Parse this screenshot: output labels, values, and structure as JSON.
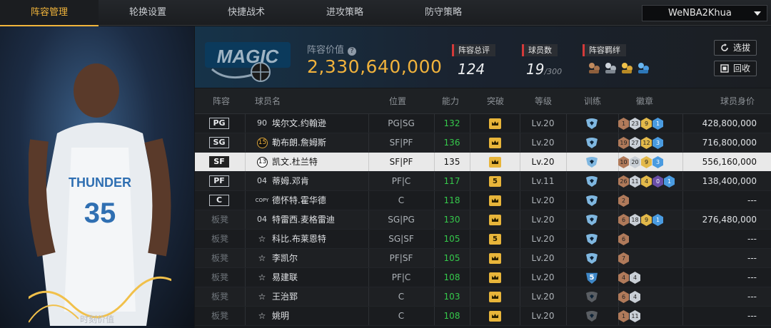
{
  "tabs": [
    "阵容管理",
    "轮换设置",
    "快捷战术",
    "进攻策略",
    "防守策略"
  ],
  "user": {
    "name": "WeNBA2Khua"
  },
  "player_panel": {
    "time_value_label": "时刻价值"
  },
  "summary": {
    "lineup_value_label": "阵容价值",
    "lineup_value": "2,330,640,000",
    "overall_label": "阵容总评",
    "overall_value": "124",
    "players_label": "球员数",
    "players_value": "19",
    "players_max": "/300",
    "bonds_label": "阵容羁绊",
    "btn_select": "选拔",
    "btn_recycle": "回收"
  },
  "columns": {
    "lineup": "阵容",
    "name": "球员名",
    "position": "位置",
    "ability": "能力",
    "breakthrough": "突破",
    "level": "等级",
    "training": "训练",
    "badges": "徽章",
    "value": "球员身价"
  },
  "colors": {
    "accent": "#f2b53b",
    "ability_green": "#35c94b",
    "stat_red": "#d43a3a"
  },
  "rows": [
    {
      "slot": "PG",
      "bench": false,
      "num": "90",
      "num_type": "plain",
      "name": "埃尔文.约翰逊",
      "position": "PG|SG",
      "ability": "132",
      "break": "crown",
      "level": "Lv.20",
      "training": "crest",
      "badges": [
        {
          "t": "bronze",
          "v": "1"
        },
        {
          "t": "silver",
          "v": "23"
        },
        {
          "t": "gold",
          "v": "9"
        },
        {
          "t": "blue",
          "v": "1"
        }
      ],
      "value": "428,800,000",
      "selected": false
    },
    {
      "slot": "SG",
      "bench": false,
      "num": "15",
      "num_type": "badge",
      "name": "勒布朗.詹姆斯",
      "position": "SF|PF",
      "ability": "136",
      "break": "crown",
      "level": "Lv.20",
      "training": "crest",
      "badges": [
        {
          "t": "bronze",
          "v": "19"
        },
        {
          "t": "silver",
          "v": "27"
        },
        {
          "t": "gold",
          "v": "12"
        },
        {
          "t": "blue",
          "v": "3"
        }
      ],
      "value": "716,800,000",
      "selected": false
    },
    {
      "slot": "SF",
      "bench": false,
      "num": "13",
      "num_type": "badge",
      "name": "凯文.杜兰特",
      "position": "SF|PF",
      "ability": "135",
      "break": "crown",
      "level": "Lv.20",
      "training": "crest",
      "badges": [
        {
          "t": "bronze",
          "v": "10"
        },
        {
          "t": "silver",
          "v": "20"
        },
        {
          "t": "gold",
          "v": "9"
        },
        {
          "t": "blue",
          "v": "3"
        }
      ],
      "value": "556,160,000",
      "selected": true
    },
    {
      "slot": "PF",
      "bench": false,
      "num": "04",
      "num_type": "plain",
      "name": "蒂姆.邓肯",
      "position": "PF|C",
      "ability": "117",
      "break": "5",
      "level": "Lv.11",
      "training": "crest",
      "badges": [
        {
          "t": "bronze",
          "v": "26"
        },
        {
          "t": "silver",
          "v": "11"
        },
        {
          "t": "gold",
          "v": "4"
        },
        {
          "t": "purple",
          "v": "0"
        },
        {
          "t": "blue",
          "v": "1"
        }
      ],
      "value": "138,400,000",
      "selected": false
    },
    {
      "slot": "C",
      "bench": false,
      "num": "COPY",
      "num_type": "copy",
      "name": "德怀特.霍华德",
      "position": "C",
      "ability": "118",
      "break": "crown",
      "level": "Lv.20",
      "training": "crest",
      "badges": [
        {
          "t": "bronze",
          "v": "2"
        }
      ],
      "value": "---",
      "selected": false
    },
    {
      "slot": "板凳",
      "bench": true,
      "num": "04",
      "num_type": "plain",
      "name": "特雷西.麦格雷迪",
      "position": "SG|PG",
      "ability": "130",
      "break": "crown",
      "level": "Lv.20",
      "training": "crest",
      "badges": [
        {
          "t": "bronze",
          "v": "6"
        },
        {
          "t": "silver",
          "v": "18"
        },
        {
          "t": "gold",
          "v": "9"
        },
        {
          "t": "blue",
          "v": "1"
        }
      ],
      "value": "276,480,000",
      "selected": false
    },
    {
      "slot": "板凳",
      "bench": true,
      "num": "☆",
      "num_type": "star",
      "name": "科比.布莱恩特",
      "position": "SG|SF",
      "ability": "105",
      "break": "5",
      "level": "Lv.20",
      "training": "crest",
      "badges": [
        {
          "t": "bronze",
          "v": "6"
        }
      ],
      "value": "---",
      "selected": false
    },
    {
      "slot": "板凳",
      "bench": true,
      "num": "☆",
      "num_type": "star",
      "name": "李凯尔",
      "position": "PF|SF",
      "ability": "105",
      "break": "crown",
      "level": "Lv.20",
      "training": "crest",
      "badges": [
        {
          "t": "bronze",
          "v": "7"
        }
      ],
      "value": "---",
      "selected": false
    },
    {
      "slot": "板凳",
      "bench": true,
      "num": "☆",
      "num_type": "star",
      "name": "易建联",
      "position": "PF|C",
      "ability": "108",
      "break": "crown",
      "level": "Lv.20",
      "training": "5",
      "badges": [
        {
          "t": "bronze",
          "v": "4"
        },
        {
          "t": "silver",
          "v": "4"
        }
      ],
      "value": "---",
      "selected": false
    },
    {
      "slot": "板凳",
      "bench": true,
      "num": "☆",
      "num_type": "star",
      "name": "王治郅",
      "position": "C",
      "ability": "103",
      "break": "crown",
      "level": "Lv.20",
      "training": "gray",
      "badges": [
        {
          "t": "bronze",
          "v": "6"
        },
        {
          "t": "silver",
          "v": "4"
        }
      ],
      "value": "---",
      "selected": false
    },
    {
      "slot": "板凳",
      "bench": true,
      "num": "☆",
      "num_type": "star",
      "name": "姚明",
      "position": "C",
      "ability": "108",
      "break": "crown",
      "level": "Lv.20",
      "training": "gray",
      "badges": [
        {
          "t": "bronze",
          "v": "1"
        },
        {
          "t": "silver",
          "v": "11"
        }
      ],
      "value": "---",
      "selected": false
    }
  ]
}
